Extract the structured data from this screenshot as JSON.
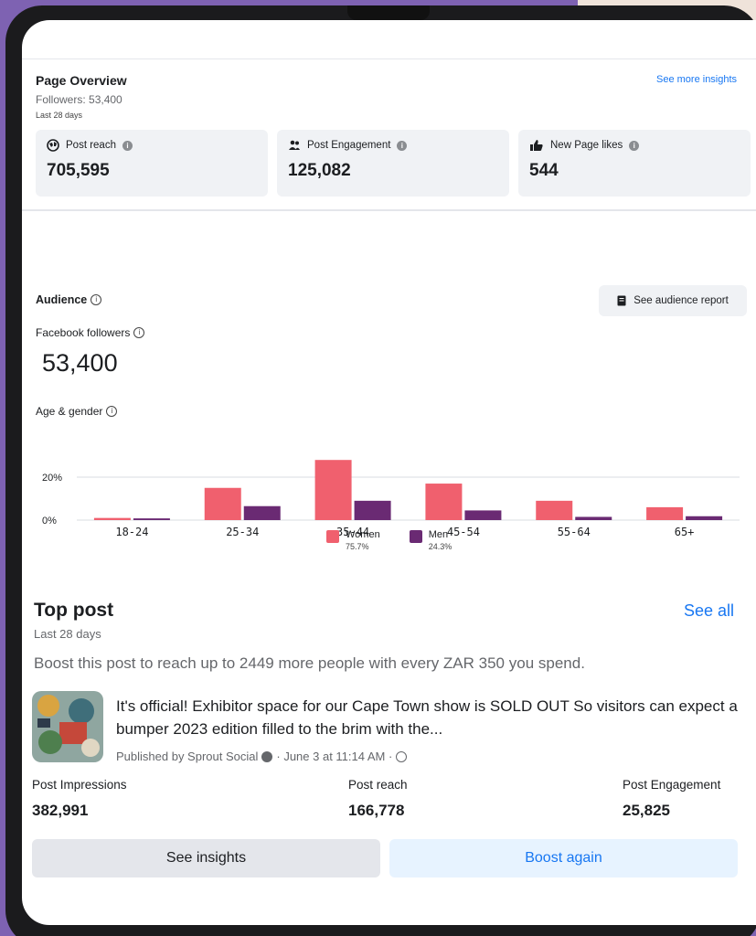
{
  "overview": {
    "title": "Page Overview",
    "followers_text": "Followers: 53,400",
    "period": "Last 28 days",
    "see_more": "See more insights",
    "cards": [
      {
        "label": "Post reach",
        "value": "705,595",
        "icon": "globe-icon"
      },
      {
        "label": "Post Engagement",
        "value": "125,082",
        "icon": "people-icon"
      },
      {
        "label": "New Page likes",
        "value": "544",
        "icon": "thumbs-up-icon"
      }
    ]
  },
  "audience": {
    "title": "Audience",
    "report_button": "See audience report",
    "followers_label": "Facebook followers",
    "followers_count": "53,400",
    "age_gender_label": "Age & gender"
  },
  "chart_data": {
    "type": "bar",
    "categories": [
      "18-24",
      "25-34",
      "35-44",
      "45-54",
      "55-64",
      "65+"
    ],
    "series": [
      {
        "name": "Women",
        "values": [
          1,
          15,
          28,
          17,
          9,
          6
        ],
        "color": "#f0606e"
      },
      {
        "name": "Men",
        "values": [
          0.8,
          6.5,
          9,
          4.5,
          1.5,
          1.8
        ],
        "color": "#6a2a73"
      }
    ],
    "ylim": [
      0,
      20
    ],
    "y_ticks": [
      "0%",
      "20%"
    ],
    "legend": [
      {
        "name": "Women",
        "pct": "75.7%"
      },
      {
        "name": "Men",
        "pct": "24.3%"
      }
    ],
    "legend_position": "bottom-center"
  },
  "top_post": {
    "title": "Top post",
    "see_all": "See all",
    "period": "Last 28 days",
    "boost_message": "Boost this post to reach up to 2449 more people with every ZAR 350 you spend.",
    "text": "It's official! Exhibitor space for our Cape Town show is SOLD OUT So visitors can expect a bumper 2023 edition filled to the brim with the...",
    "published_prefix": "Published by Sprout Social",
    "published_date": "· June 3 at 11:14 AM ·",
    "stats": [
      {
        "label": "Post Impressions",
        "value": "382,991"
      },
      {
        "label": "Post reach",
        "value": "166,778"
      },
      {
        "label": "Post Engagement",
        "value": "25,825"
      }
    ],
    "see_insights": "See insights",
    "boost_again": "Boost again"
  },
  "colors": {
    "accent": "#1877f2",
    "women": "#f0606e",
    "men": "#6a2a73",
    "background": "#7e62b2"
  }
}
